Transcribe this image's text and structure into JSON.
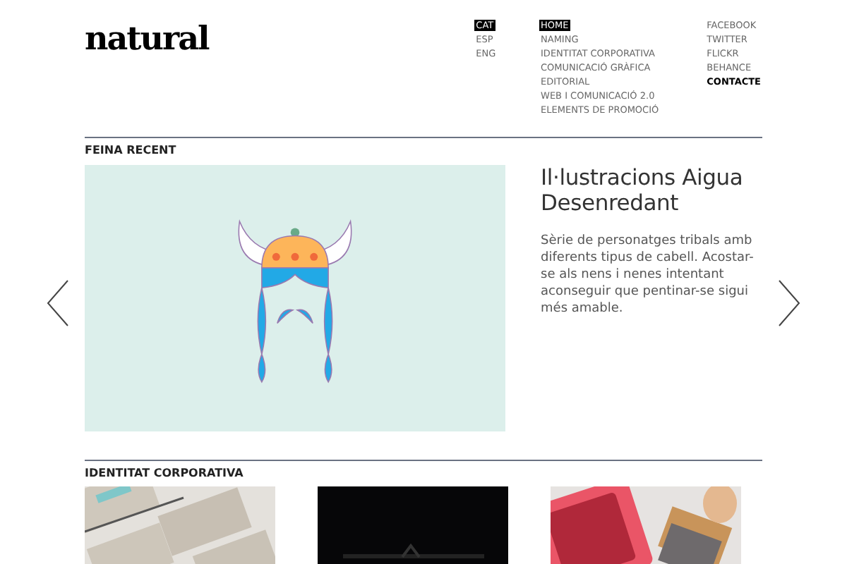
{
  "logo": "natural",
  "languages": [
    {
      "label": "CAT",
      "selected": true
    },
    {
      "label": "ESP",
      "selected": false
    },
    {
      "label": "ENG",
      "selected": false
    }
  ],
  "nav": [
    {
      "label": "HOME",
      "selected": true
    },
    {
      "label": "NAMING",
      "selected": false
    },
    {
      "label": "IDENTITAT CORPORATIVA",
      "selected": false
    },
    {
      "label": "COMUNICACIÓ GRÀFICA",
      "selected": false
    },
    {
      "label": "EDITORIAL",
      "selected": false
    },
    {
      "label": "WEB I COMUNICACIÓ 2.0",
      "selected": false
    },
    {
      "label": "ELEMENTS DE PROMOCIÓ",
      "selected": false
    }
  ],
  "social": [
    {
      "label": "FACEBOOK",
      "bold": false
    },
    {
      "label": "TWITTER",
      "bold": false
    },
    {
      "label": "FLICKR",
      "bold": false
    },
    {
      "label": "BEHANCE",
      "bold": false
    },
    {
      "label": "CONTACTE",
      "bold": true
    }
  ],
  "recent": {
    "heading": "FEINA RECENT",
    "title": "Il·lustracions Aigua Desenredant",
    "description": "Sèrie de personatges tribals amb diferents tipus de cabell. Acostar-se als nens i nenes intentant aconseguir que pentinar-se sigui més amable."
  },
  "section": {
    "heading": "IDENTITAT CORPORATIVA",
    "items": [
      {
        "kind": "cards"
      },
      {
        "kind": "dark"
      },
      {
        "kind": "stamp"
      }
    ]
  }
}
